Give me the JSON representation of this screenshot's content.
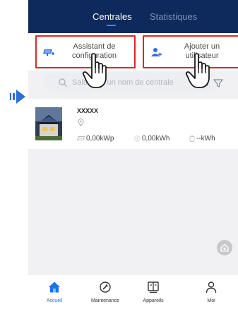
{
  "header": {
    "tabs": [
      {
        "label": "Centrales",
        "active": true
      },
      {
        "label": "Statistiques",
        "active": false
      }
    ]
  },
  "actions": [
    {
      "label": "Assistant de configuration",
      "icon": "configuration-wizard-icon"
    },
    {
      "label": "Ajouter un utilisateur",
      "icon": "add-user-icon"
    }
  ],
  "search": {
    "placeholder": "Saisissez un nom de centrale"
  },
  "plants": [
    {
      "name": "XXXXX",
      "power": "0,00kWp",
      "energy": "0,00kWh",
      "yield": "--kWh"
    }
  ],
  "bottom_nav": [
    {
      "label": "Accueil",
      "icon": "home-icon",
      "active": true
    },
    {
      "label": "Maintenance",
      "icon": "maintenance-icon",
      "active": false
    },
    {
      "label": "Appareils",
      "icon": "devices-icon",
      "active": false
    },
    {
      "label": "Moi",
      "icon": "user-icon",
      "active": false
    }
  ],
  "colors": {
    "header_bg": "#0e2a5c",
    "accent": "#1a73e8",
    "highlight_border": "#d72a2a",
    "pointer_arrow": "#2c6fd6"
  }
}
